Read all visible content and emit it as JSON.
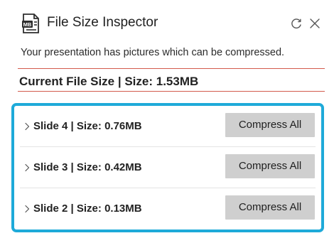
{
  "header": {
    "title": "File Size Inspector",
    "icon": "mb-file-icon",
    "refresh_icon": "refresh-icon",
    "close_icon": "close-icon"
  },
  "message": "Your presentation has pictures which can be compressed.",
  "current_file": {
    "label": "Current File Size | Size: 1.53MB",
    "size_mb": 1.53
  },
  "slides": [
    {
      "label": "Slide 4 | Size: 0.76MB",
      "slide": 4,
      "size_mb": 0.76,
      "button_label": "Compress All"
    },
    {
      "label": "Slide 3 | Size: 0.42MB",
      "slide": 3,
      "size_mb": 0.42,
      "button_label": "Compress All"
    },
    {
      "label": "Slide 2 | Size: 0.13MB",
      "slide": 2,
      "size_mb": 0.13,
      "button_label": "Compress All"
    }
  ],
  "colors": {
    "accent_border": "#1eaad9",
    "rule": "#d35a4c",
    "button": "#cfcfcf"
  }
}
